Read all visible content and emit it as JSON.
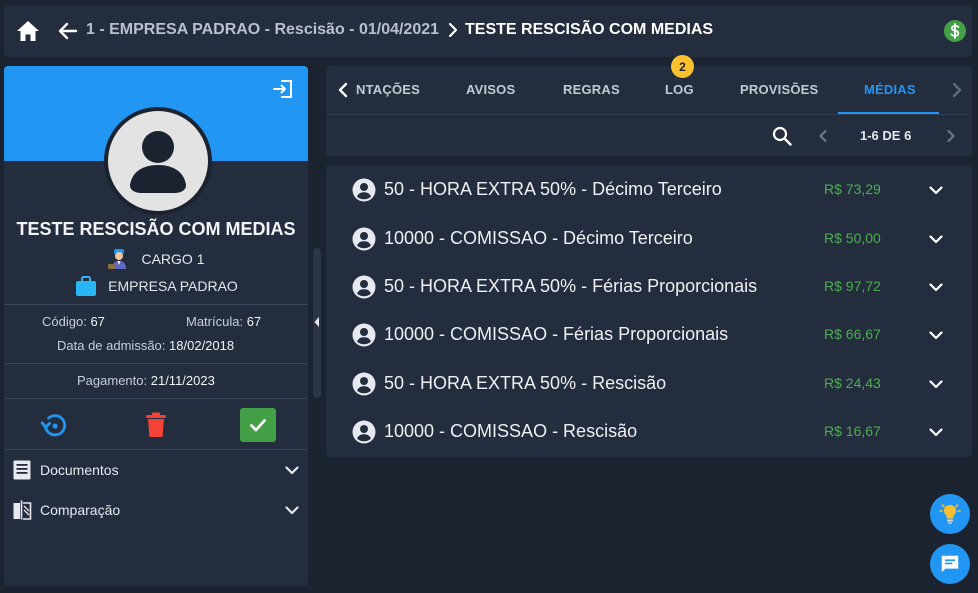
{
  "topbar": {
    "breadcrumb_parent": "1 - EMPRESA PADRAO - Rescisão - 01/04/2021",
    "breadcrumb_current": "TESTE RESCISÃO COM MEDIAS",
    "icons": [
      "home-icon",
      "arrow-left-icon",
      "chevron-right-icon",
      "dollar-circle-icon"
    ]
  },
  "employee": {
    "name": "TESTE RESCISÃO COM MEDIAS",
    "cargo": "CARGO 1",
    "empresa": "EMPRESA PADRAO",
    "codigo_label": "Código:",
    "codigo": "67",
    "matricula_label": "Matrícula:",
    "matricula": "67",
    "admissao_label": "Data de admissão:",
    "admissao": "18/02/2018",
    "pagamento_label": "Pagamento:",
    "pagamento": "21/11/2023"
  },
  "sections": [
    {
      "label": "Documentos"
    },
    {
      "label": "Comparação"
    }
  ],
  "tabs": [
    {
      "label": "NTAÇÕES"
    },
    {
      "label": "AVISOS"
    },
    {
      "label": "REGRAS"
    },
    {
      "label": "LOG"
    },
    {
      "label": "PROVISÕES"
    },
    {
      "label": "MÉDIAS"
    }
  ],
  "log_badge": "2",
  "pagination": "1-6 DE 6",
  "items": [
    {
      "label": "50 - HORA EXTRA 50% - Décimo Terceiro",
      "value": "R$ 73,29"
    },
    {
      "label": "10000 - COMISSAO - Décimo Terceiro",
      "value": "R$ 50,00"
    },
    {
      "label": "50 - HORA EXTRA 50% - Férias Proporcionais",
      "value": "R$ 97,72"
    },
    {
      "label": "10000 - COMISSAO - Férias Proporcionais",
      "value": "R$ 66,67"
    },
    {
      "label": "50 - HORA EXTRA 50% - Rescisão",
      "value": "R$ 24,43"
    },
    {
      "label": "10000 - COMISSAO - Rescisão",
      "value": "R$ 16,67"
    }
  ],
  "colors": {
    "accent": "#2196f3",
    "value_green": "#4caf50",
    "delete_red": "#f44336",
    "confirm_green": "#43a047",
    "badge_yellow": "#fbc02d"
  }
}
